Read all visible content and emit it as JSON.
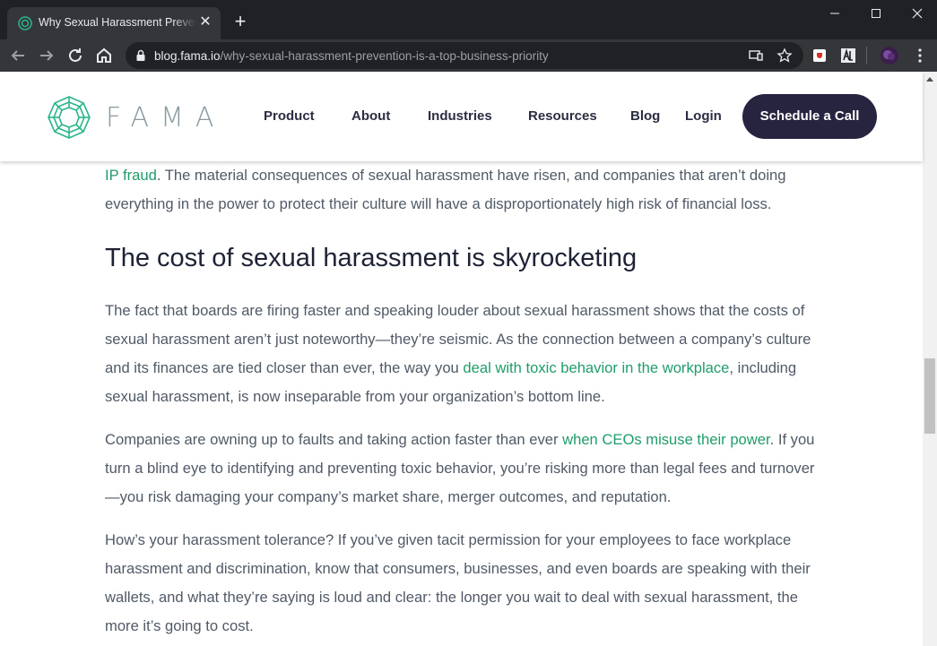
{
  "browser": {
    "tab_title": "Why Sexual Harassment Prevention is a Top Business Priority",
    "tab_close": "✕",
    "new_tab": "+",
    "url_host": "blog.fama.io",
    "url_path": "/why-sexual-harassment-prevention-is-a-top-business-priority"
  },
  "header": {
    "logo_text": "FAMA",
    "nav": [
      "Product",
      "About",
      "Industries",
      "Resources",
      "Blog",
      "Login"
    ],
    "cta": "Schedule a Call"
  },
  "article": {
    "p0_link": "IP fraud",
    "p0_text": ". The material consequences of sexual harassment have risen, and companies that aren’t doing everything in the power to protect their culture will have a disproportionately high risk of financial loss.",
    "heading": "The cost of sexual harassment is skyrocketing",
    "p1_before": "The fact that boards are firing faster and speaking louder about sexual harassment shows that the costs of sexual harassment aren’t just noteworthy—they’re seismic. As the connection between a company’s culture and its finances are tied closer than ever, the way you ",
    "p1_link": "deal with toxic behavior in the workplace",
    "p1_after": ", including sexual harassment, is now inseparable from your organization’s bottom line.",
    "p2_before": "Companies are owning up to faults and taking action faster than ever ",
    "p2_link": "when CEOs misuse their power",
    "p2_after": ". If you turn a blind eye to identifying and preventing toxic behavior, you’re risking more than legal fees and turnover—you risk damaging your company’s market share, merger outcomes, and reputation.",
    "p3": "How’s your harassment tolerance? If you’ve given tacit permission for your employees to face workplace harassment and discrimination, know that consumers, businesses, and even boards are speaking with their wallets, and what they’re saying is loud and clear: the longer you wait to deal with sexual harassment, the more it’s going to cost."
  },
  "colors": {
    "chrome_dark": "#202124",
    "chrome_toolbar": "#35363a",
    "brand_teal": "#2bb58a",
    "link_green": "#1f9d6b",
    "cta_bg": "#26243f",
    "heading": "#1e2235",
    "body_text": "#505a66"
  }
}
